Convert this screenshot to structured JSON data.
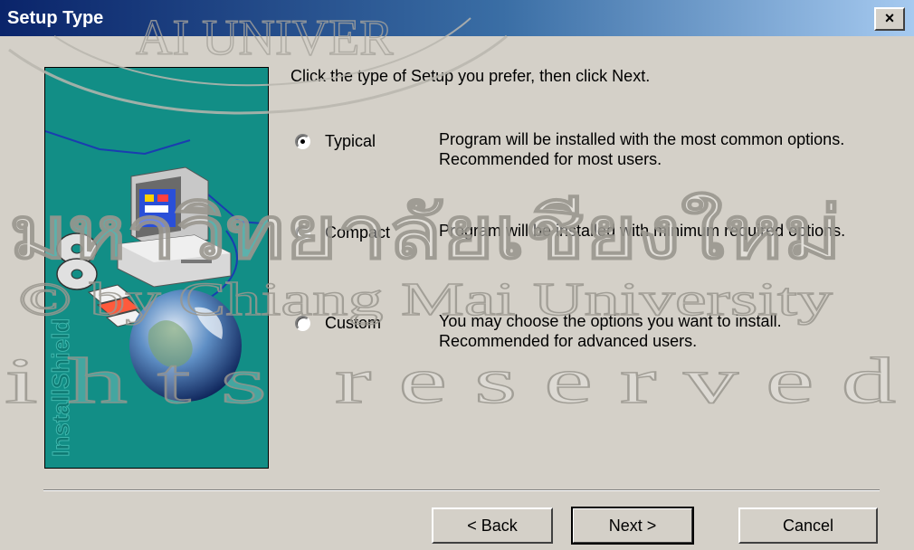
{
  "window": {
    "title": "Setup Type",
    "close_glyph": "×"
  },
  "banner": {
    "brand_text": "InstallShield",
    "icons": [
      "computer-icon",
      "cd-discs-icon",
      "floppy-disks-icon",
      "globe-icon"
    ]
  },
  "instruction": "Click the type of Setup you prefer, then click Next.",
  "options": [
    {
      "label": "Typical",
      "selected": true,
      "description": "Program will be installed with the most common options.  Recommended for most users."
    },
    {
      "label": "Compact",
      "selected": false,
      "description": "Program will be installed with minimum required options."
    },
    {
      "label": "Custom",
      "selected": false,
      "description": "You may choose the options you want to install. Recommended for advanced users."
    }
  ],
  "buttons": {
    "back": "< Back",
    "next": "Next >",
    "cancel": "Cancel"
  },
  "watermark": {
    "line1": "มหาวิทยาลัยเชียงใหม่",
    "line2": "© by Chiang Mai University",
    "line3": "r e s e r v e d",
    "line4": "i h t s",
    "arc_text": "AI UNIVER"
  },
  "colors": {
    "dialog_bg": "#d4d0c8",
    "title_start": "#0a246a",
    "title_end": "#a6caf0",
    "banner_bg": "#128e86"
  }
}
